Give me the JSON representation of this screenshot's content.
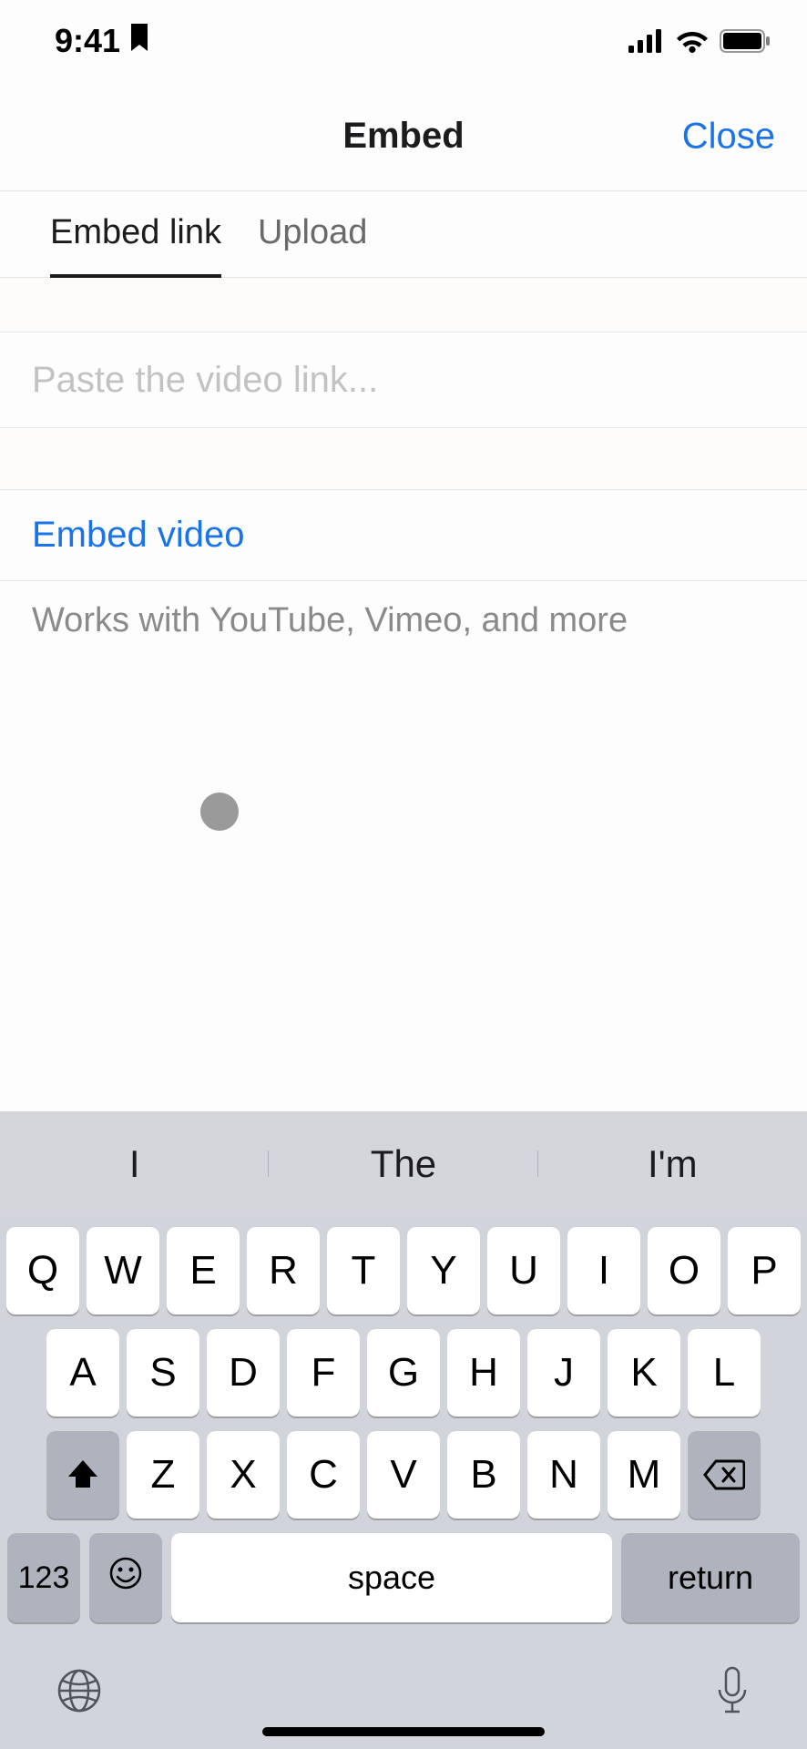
{
  "status": {
    "time": "9:41",
    "bookmark_icon": "bookmark-icon"
  },
  "header": {
    "title": "Embed",
    "close_label": "Close"
  },
  "tabs": {
    "items": [
      "Embed link",
      "Upload"
    ],
    "active_index": 0
  },
  "input": {
    "placeholder": "Paste the video link...",
    "value": ""
  },
  "action": {
    "label": "Embed video"
  },
  "hint": {
    "text": "Works with YouTube, Vimeo, and more"
  },
  "keyboard": {
    "suggestions": [
      "I",
      "The",
      "I'm"
    ],
    "row1": [
      "Q",
      "W",
      "E",
      "R",
      "T",
      "Y",
      "U",
      "I",
      "O",
      "P"
    ],
    "row2": [
      "A",
      "S",
      "D",
      "F",
      "G",
      "H",
      "J",
      "K",
      "L"
    ],
    "row3": [
      "Z",
      "X",
      "C",
      "V",
      "B",
      "N",
      "M"
    ],
    "numbers_label": "123",
    "space_label": "space",
    "return_label": "return"
  },
  "colors": {
    "accent": "#1a73e8",
    "keyboard_bg": "#d1d4da",
    "key_bg": "#ffffff",
    "fn_key_bg": "#aeb3bd"
  }
}
